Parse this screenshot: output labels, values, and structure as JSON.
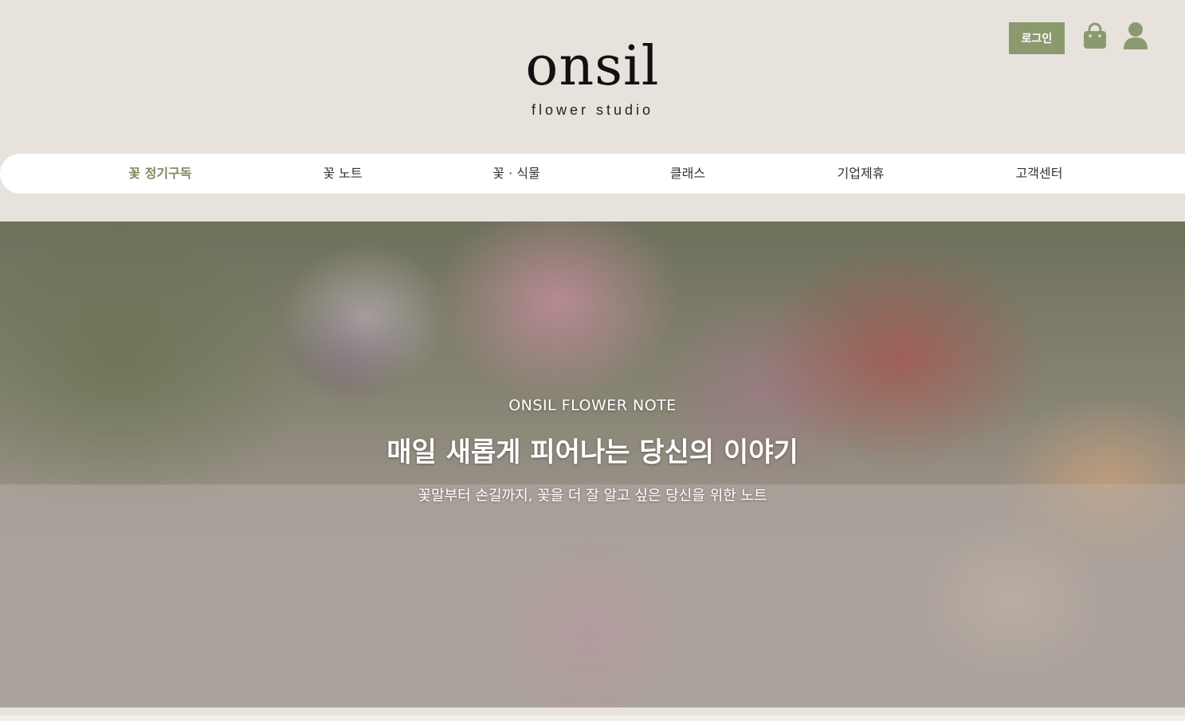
{
  "header": {
    "login_label": "로그인",
    "logo_main": "onsil",
    "logo_sub": "flower studio",
    "icons": {
      "cart": "shopping-bag-icon",
      "user": "user-icon"
    },
    "colors": {
      "accent": "#8a9a6e",
      "background": "#e7e3dc"
    }
  },
  "nav": {
    "items": [
      {
        "label": "꽃 정기구독",
        "active": true
      },
      {
        "label": "꽃 노트",
        "active": false
      },
      {
        "label": "꽃 · 식물",
        "active": false
      },
      {
        "label": "클래스",
        "active": false
      },
      {
        "label": "기업제휴",
        "active": false
      },
      {
        "label": "고객센터",
        "active": false
      }
    ]
  },
  "hero": {
    "eyebrow": "ONSIL FLOWER NOTE",
    "title": "매일 새롭게 피어나는 당신의 이야기",
    "description": "꽃말부터 손길까지, 꽃을 더 잘 알고 싶은 당신을 위한 노트"
  }
}
